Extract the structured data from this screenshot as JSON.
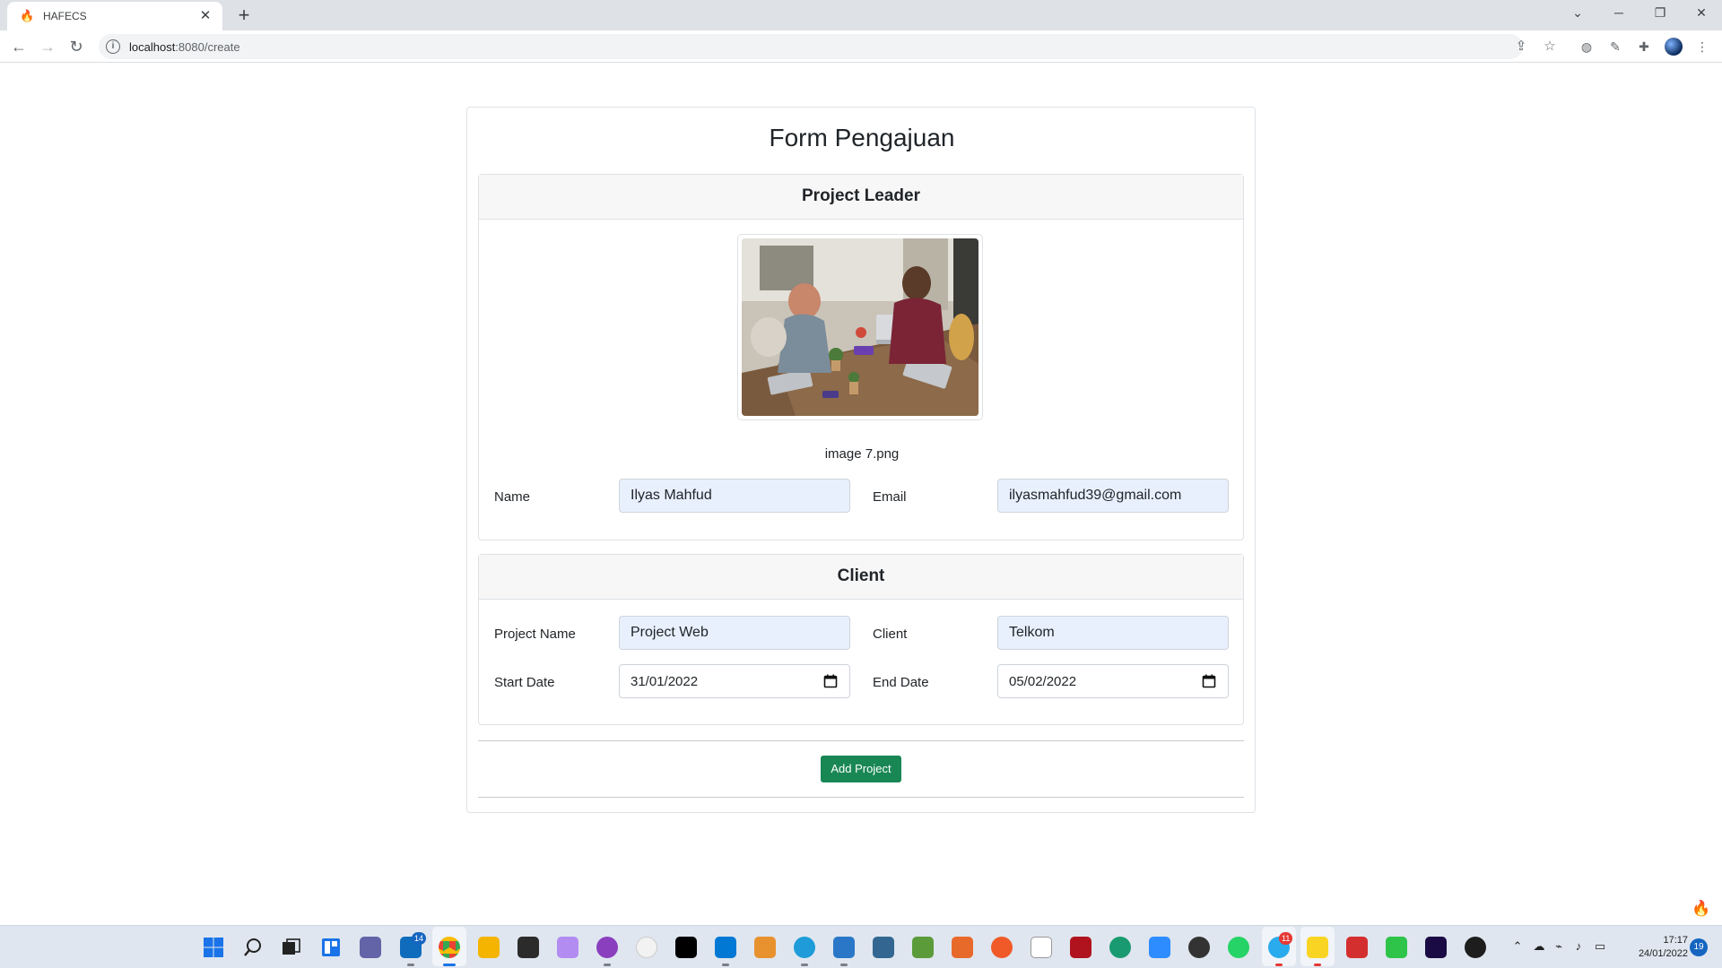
{
  "browser": {
    "tab_title": "HAFECS",
    "tab_close": "✕",
    "new_tab": "+",
    "url_host": "localhost",
    "url_path": ":8080/create"
  },
  "page": {
    "title": "Form Pengajuan",
    "project_leader": {
      "heading": "Project Leader",
      "image_caption": "image 7.png",
      "name_label": "Name",
      "name_value": "Ilyas Mahfud",
      "email_label": "Email",
      "email_value": "ilyasmahfud39@gmail.com"
    },
    "client": {
      "heading": "Client",
      "project_name_label": "Project Name",
      "project_name_value": "Project Web",
      "client_label": "Client",
      "client_value": "Telkom",
      "start_date_label": "Start Date",
      "start_date_value": "31/01/2022",
      "end_date_label": "End Date",
      "end_date_value": "05/02/2022"
    },
    "submit_label": "Add Project"
  },
  "taskbar": {
    "mail_badge": "14",
    "telegram_badge": "11",
    "clock_time": "17:17",
    "clock_date": "24/01/2022",
    "notification_count": "19"
  },
  "colors": {
    "primary_button": "#198754",
    "autofill_background": "#e8f0fe",
    "card_header": "#f7f7f7"
  }
}
